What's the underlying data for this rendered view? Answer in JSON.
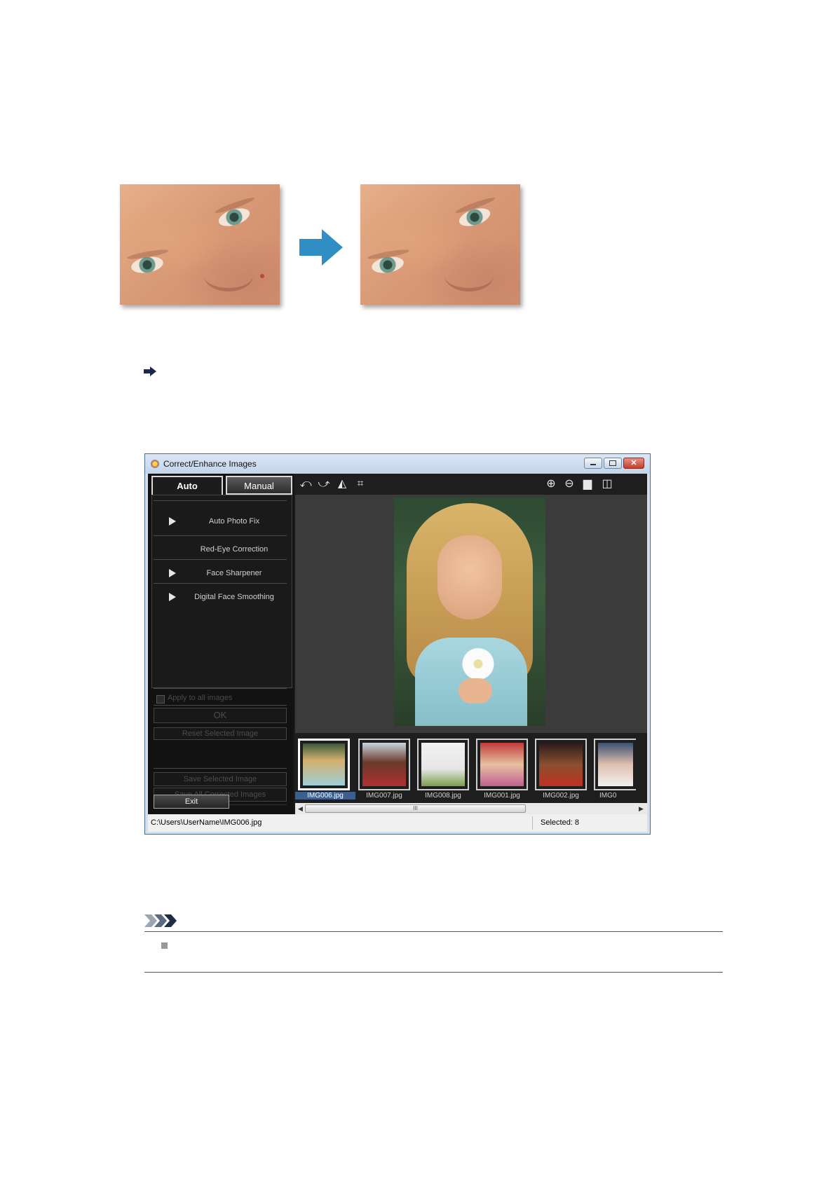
{
  "window": {
    "title": "Correct/Enhance Images",
    "tabs": {
      "auto": "Auto",
      "manual": "Manual"
    },
    "menu": [
      {
        "label": "Auto Photo Fix",
        "has_arrow": true
      },
      {
        "label": "Red-Eye Correction",
        "has_arrow": false
      },
      {
        "label": "Face Sharpener",
        "has_arrow": true
      },
      {
        "label": "Digital Face Smoothing",
        "has_arrow": true
      }
    ],
    "apply_all_label": "Apply to all images",
    "ok_label": "OK",
    "reset_label": "Reset Selected Image",
    "save_selected_label": "Save Selected Image",
    "save_all_label": "Save All Corrected Images",
    "exit_label": "Exit",
    "thumbnails": [
      {
        "label": "IMG006.jpg",
        "selected": true
      },
      {
        "label": "IMG007.jpg",
        "selected": false
      },
      {
        "label": "IMG008.jpg",
        "selected": false
      },
      {
        "label": "IMG001.jpg",
        "selected": false
      },
      {
        "label": "IMG002.jpg",
        "selected": false
      },
      {
        "label": "IMG0",
        "selected": false
      }
    ],
    "status": {
      "path": "C:\\Users\\UserName\\IMG006.jpg",
      "selected": "Selected: 8"
    },
    "toolbar_icons": [
      "rotate-left-icon",
      "rotate-right-icon",
      "flip-icon",
      "crop-icon",
      "zoom-in-icon",
      "zoom-out-icon",
      "full-screen-icon",
      "compare-icon"
    ],
    "scroll_grip": "III"
  },
  "colors": {
    "arrow": "#2f8fc4",
    "selection": "#3d5f8f"
  }
}
